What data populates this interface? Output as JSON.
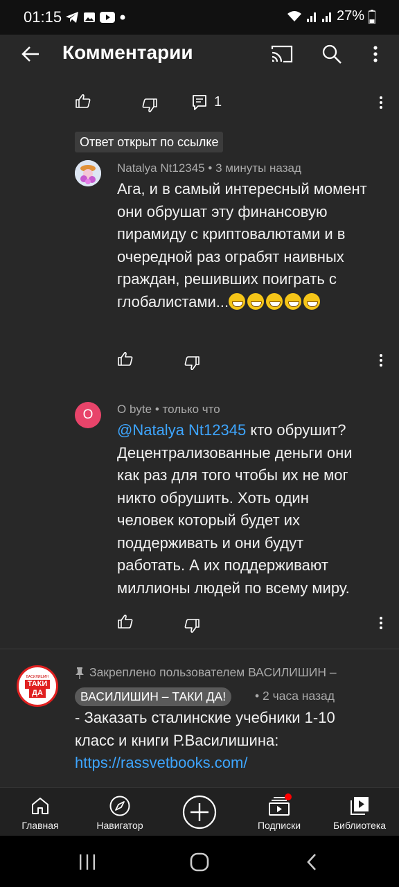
{
  "status_bar": {
    "time": "01:15",
    "battery": "27%"
  },
  "header": {
    "title": "Комментарии"
  },
  "parent_comment_actions": {
    "reply_count": "1"
  },
  "linked_tag": "Ответ открыт по ссылке",
  "comments": [
    {
      "author": "Natalya Nt12345",
      "time": "3 минуты назад",
      "text": "Ага, и в самый интересный момент они обрушат эту финансовую пирамиду с криптовалютами и в очередной раз ограбят наивных граждан, решивших поиграть с глобалистами...",
      "emoji": [
        "😂",
        "😂",
        "😂",
        "😂",
        "😂"
      ]
    },
    {
      "author": "O byte",
      "avatar_letter": "O",
      "time": "только что",
      "mention": "@Natalya Nt12345",
      "text": " кто обрушит? Децентрализованные деньги они как раз для того чтобы их не мог никто обрушить. Хоть один человек который будет их поддерживать и они будут работать. А их поддерживают миллионы людей по всему миру."
    }
  ],
  "pinned": {
    "pinned_by": "Закреплено пользователем ВАСИЛИШИН –",
    "author_chip": "ВАСИЛИШИН – ТАКИ ДА!",
    "time": "2 часа назад",
    "text": "- Заказать сталинские учебники 1-10 класс и книги Р.Василишина:",
    "link": "https://rassvetbooks.com/",
    "avatar_text_small": "ВАСИЛИШИН",
    "avatar_text_line1": "ТАКИ",
    "avatar_text_line2": "ДА"
  },
  "bottom_nav": [
    {
      "label": "Главная",
      "icon": "home-icon"
    },
    {
      "label": "Навигатор",
      "icon": "compass-icon"
    },
    {
      "label": "",
      "icon": "create-icon"
    },
    {
      "label": "Подписки",
      "icon": "subscriptions-icon"
    },
    {
      "label": "Библиотека",
      "icon": "library-icon"
    }
  ],
  "colors": {
    "background": "#282828",
    "link": "#3ea6ff",
    "avatar_o": "#e8446a",
    "notification": "#ff0000"
  }
}
